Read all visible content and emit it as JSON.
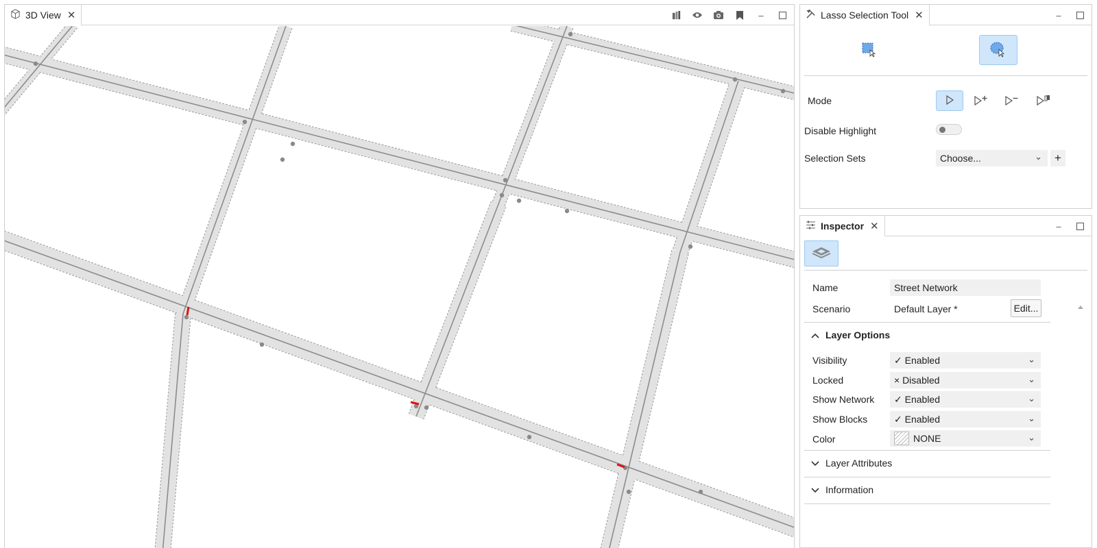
{
  "view3d": {
    "tab_label": "3D View",
    "header_icons": [
      "layers-icon",
      "eye-icon",
      "camera-icon",
      "bookmark-icon",
      "minimize-icon",
      "maximize-icon"
    ]
  },
  "lasso": {
    "tab_label": "Lasso Selection Tool",
    "shapes": [
      {
        "name": "rectangle-select-icon",
        "active": false
      },
      {
        "name": "lasso-select-icon",
        "active": true
      }
    ],
    "mode_label": "Mode",
    "modes": [
      {
        "name": "select-mode-icon",
        "active": true
      },
      {
        "name": "add-mode-icon",
        "active": false
      },
      {
        "name": "subtract-mode-icon",
        "active": false
      },
      {
        "name": "intersect-mode-icon",
        "active": false
      }
    ],
    "disable_highlight_label": "Disable Highlight",
    "disable_highlight_on": false,
    "selection_sets_label": "Selection Sets",
    "selection_sets_value": "Choose...",
    "add_symbol": "+"
  },
  "inspector": {
    "tab_label": "Inspector",
    "name_label": "Name",
    "name_value": "Street Network",
    "scenario_label": "Scenario",
    "scenario_value": "Default Layer *",
    "edit_label": "Edit...",
    "layer_options": {
      "title": "Layer Options",
      "rows": [
        {
          "label": "Visibility",
          "value": "✓ Enabled"
        },
        {
          "label": "Locked",
          "value": "× Disabled"
        },
        {
          "label": "Show Network",
          "value": "✓ Enabled"
        },
        {
          "label": "Show Blocks",
          "value": "✓ Enabled"
        }
      ],
      "color_label": "Color",
      "color_value": "NONE"
    },
    "layer_attributes_title": "Layer Attributes",
    "information_title": "Information"
  },
  "colors": {
    "road_fill": "#e2e2e2",
    "road_edge": "#9a9a9a",
    "centerline": "#8c8c8c",
    "selection_red": "#e01010",
    "accent_active": "#cfe6fb"
  }
}
